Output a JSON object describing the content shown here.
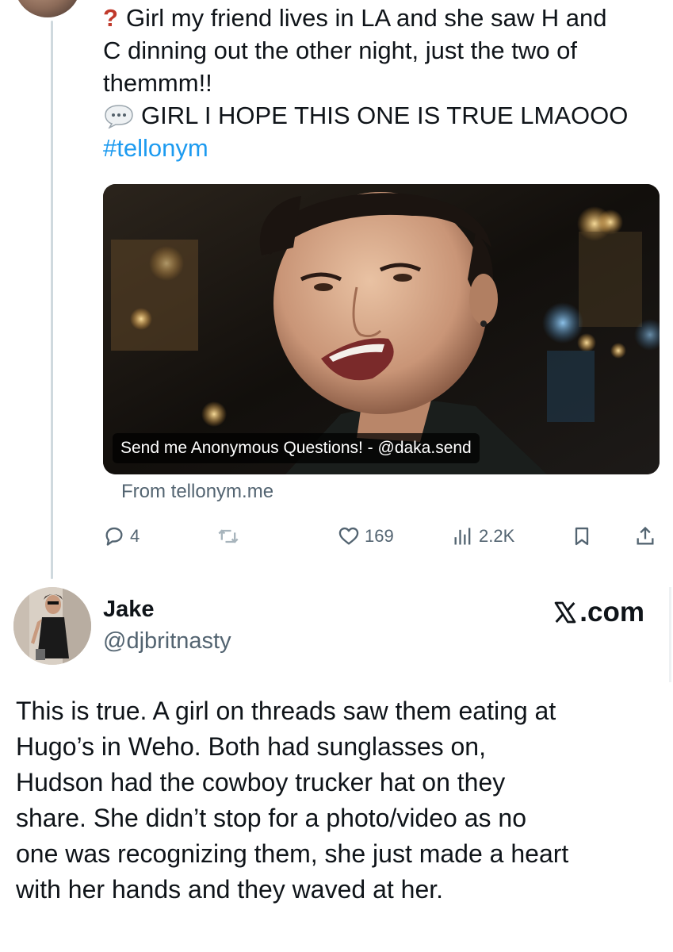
{
  "first_tweet": {
    "question_marker": "?",
    "question_lines": [
      "Girl my friend lives in LA and she saw H and",
      "C dinning out the other night, just the two of",
      "themmm!!"
    ],
    "answer_text": "GIRL I HOPE THIS ONE IS TRUE LMAOOO",
    "hashtag": "#tellonym",
    "media_caption": "Send me Anonymous Questions! - @daka.send",
    "source_link": "From tellonym.me",
    "actions": {
      "reply_count": "4",
      "retweet_count": "",
      "like_count": "169",
      "views_count": "2.2K"
    }
  },
  "second_tweet": {
    "author_name": "Jake",
    "author_handle": "@djbritnasty",
    "site_label": ".com",
    "body_lines": [
      "This is true. A girl on threads saw them eating at",
      "Hugo’s in Weho. Both had sunglasses on,",
      "Hudson had the cowboy trucker hat on they",
      "share. She didn’t stop for a photo/video as no",
      "one was recognizing them, she just made a heart",
      "with her hands and they waved at her."
    ]
  },
  "colors": {
    "text": "#0f1419",
    "muted": "#536471",
    "link": "#1d9bf0",
    "question_red": "#c0392b",
    "thread_line": "#cfd9de"
  },
  "icons": {
    "reply": "reply-icon",
    "retweet": "retweet-icon",
    "like": "heart-icon",
    "views": "views-icon",
    "bookmark": "bookmark-icon",
    "share": "share-icon",
    "speech": "speech-bubble-icon",
    "x_logo": "x-logo-icon"
  }
}
